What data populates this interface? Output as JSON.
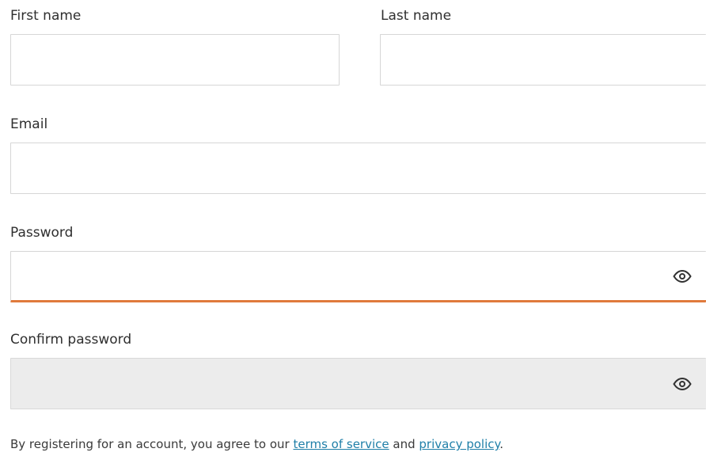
{
  "form": {
    "first_name": {
      "label": "First name",
      "value": "",
      "placeholder": ""
    },
    "last_name": {
      "label": "Last name",
      "value": "",
      "placeholder": ""
    },
    "email": {
      "label": "Email",
      "value": "",
      "placeholder": ""
    },
    "password": {
      "label": "Password",
      "value": "",
      "placeholder": "",
      "state": "focused",
      "reveal_icon": "eye-icon"
    },
    "confirm_password": {
      "label": "Confirm password",
      "value": "",
      "placeholder": "",
      "state": "disabled",
      "reveal_icon": "eye-icon"
    },
    "consent": {
      "prefix": "By registering for an account, you agree to our ",
      "terms_link": "terms of service",
      "middle": " and ",
      "privacy_link": "privacy policy",
      "suffix": "."
    }
  },
  "colors": {
    "focus_accent": "#e07a3c",
    "link": "#1f7fa8",
    "disabled_bg": "#ececec",
    "border": "#d6d6d6"
  }
}
